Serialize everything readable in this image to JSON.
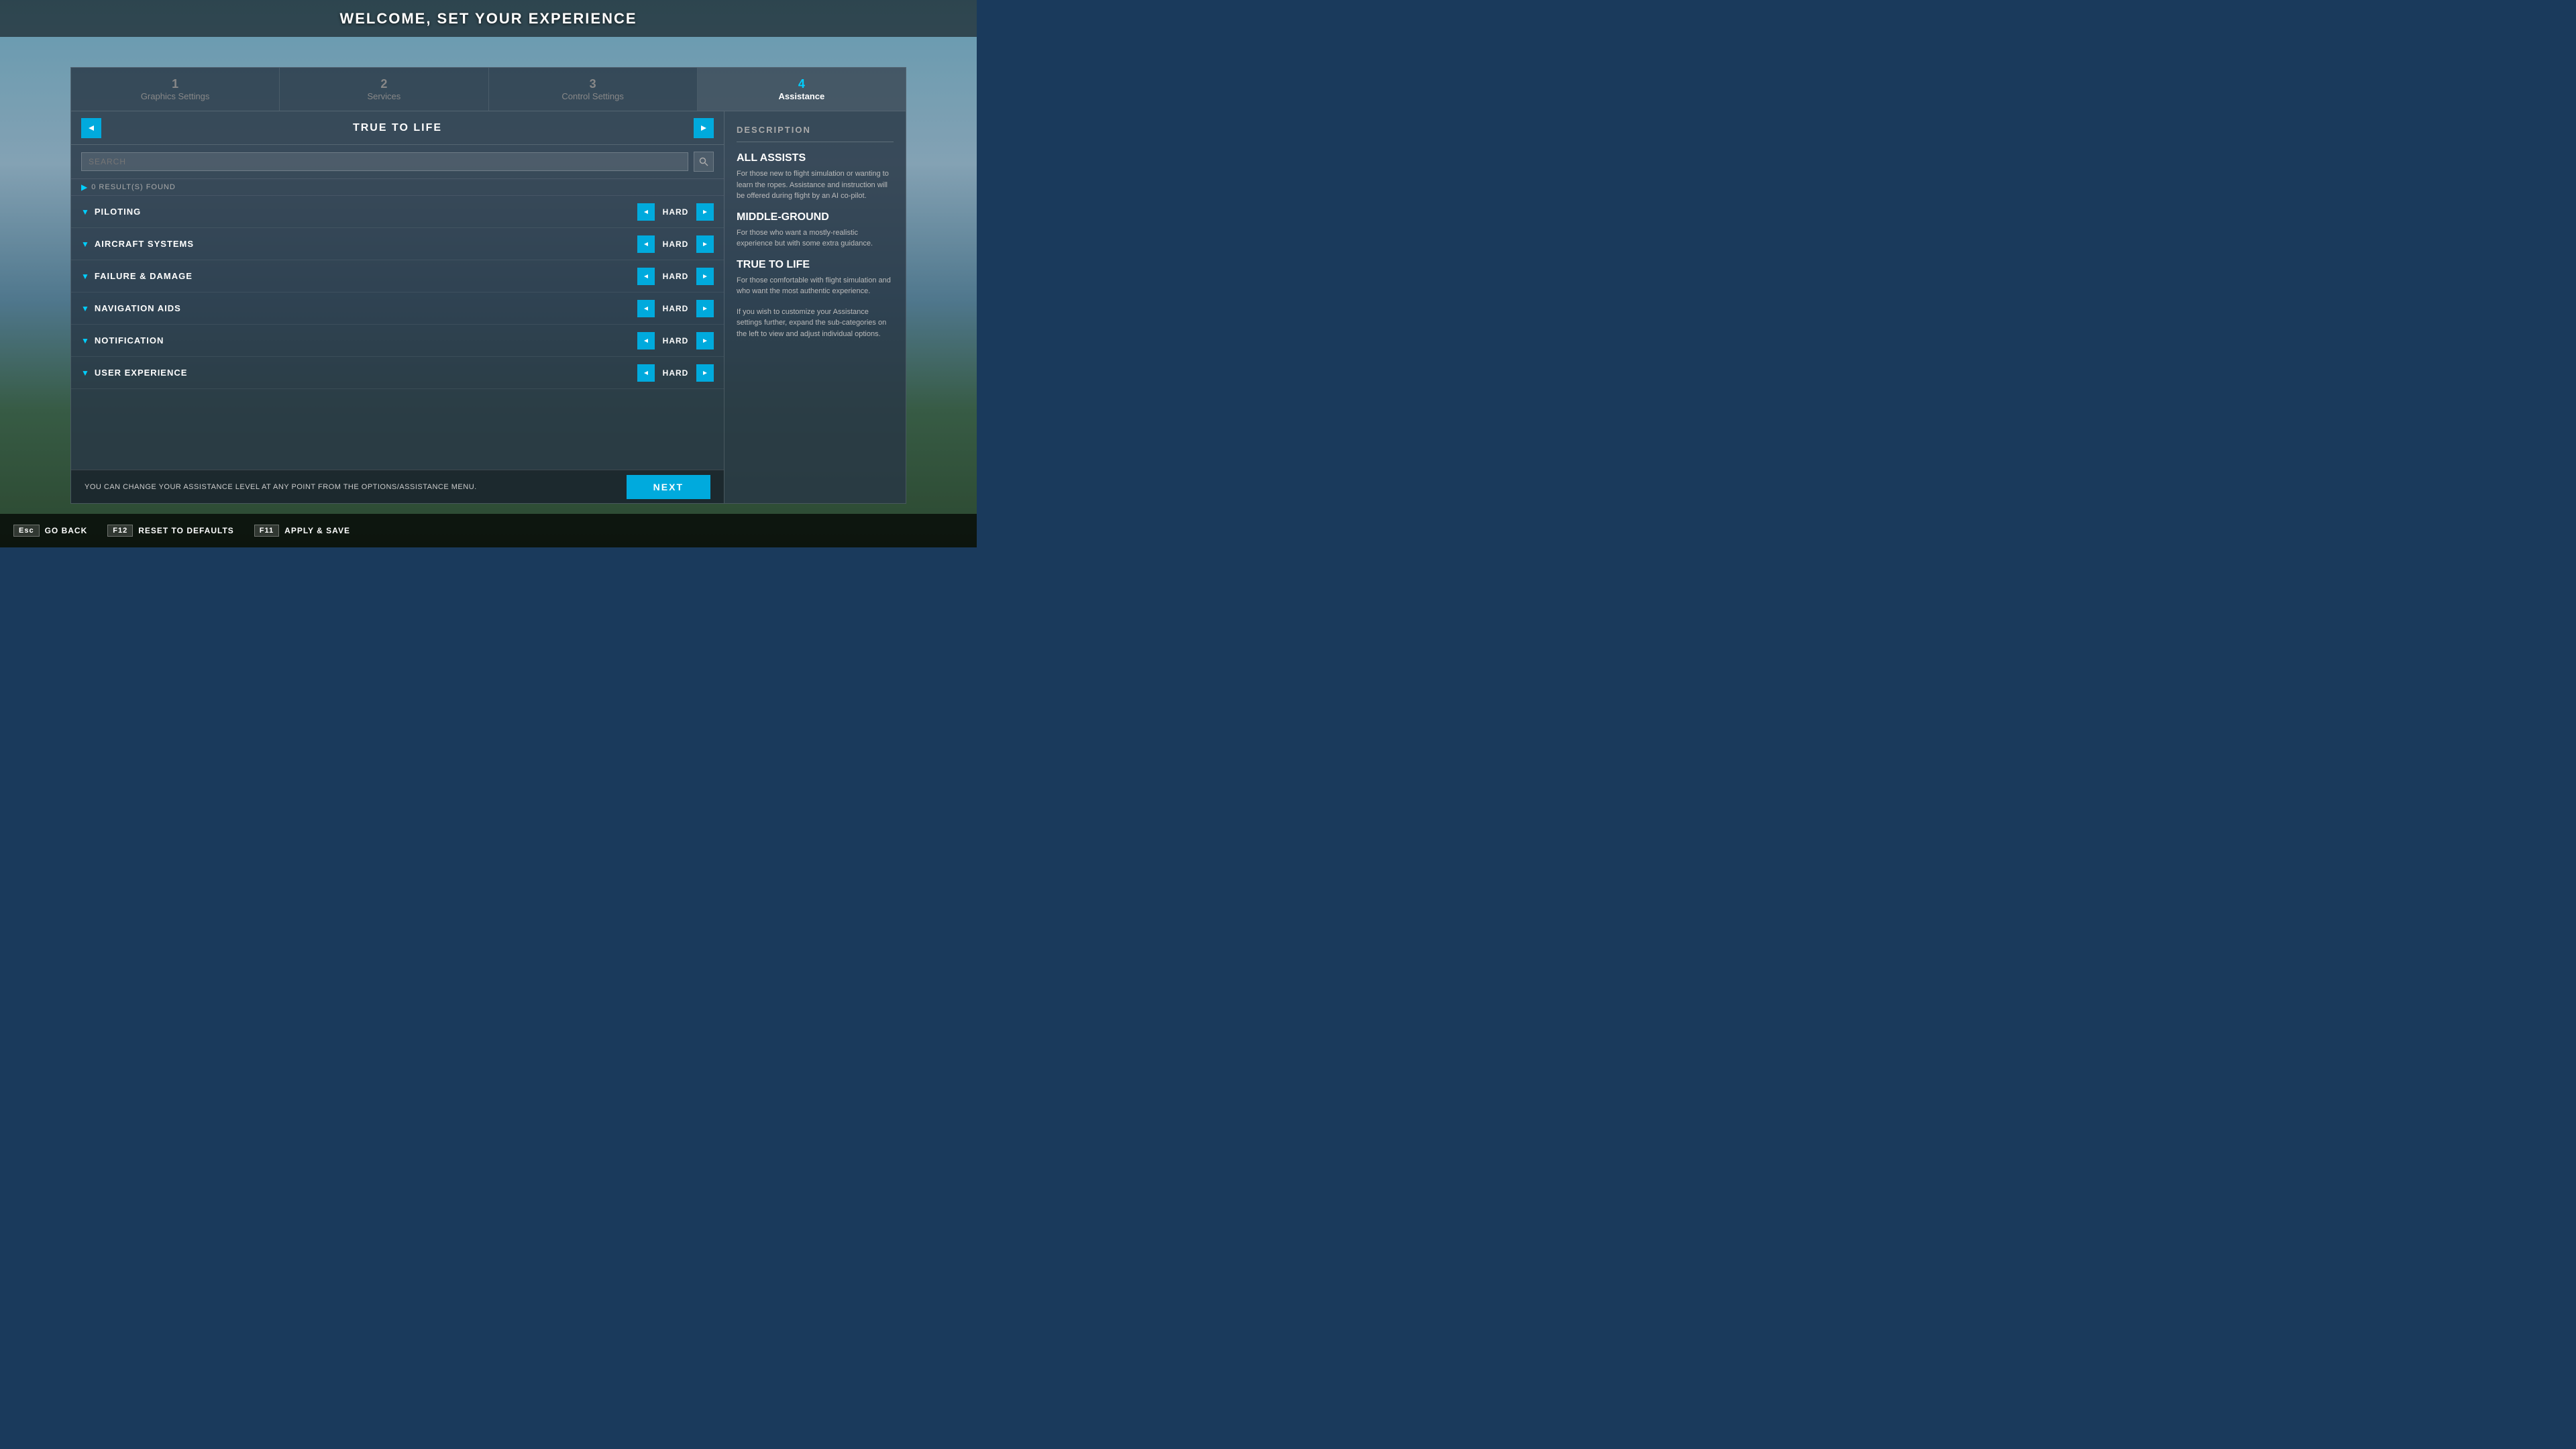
{
  "page": {
    "title": "WELCOME, SET YOUR EXPERIENCE"
  },
  "steps": [
    {
      "num": "1",
      "label": "Graphics Settings",
      "active": false
    },
    {
      "num": "2",
      "label": "Services",
      "active": false
    },
    {
      "num": "3",
      "label": "Control Settings",
      "active": false
    },
    {
      "num": "4",
      "label": "Assistance",
      "active": true
    }
  ],
  "panel": {
    "prev_label": "◀",
    "next_label": "▶",
    "title": "TRUE TO LIFE",
    "search_placeholder": "SEARCH",
    "results_text": "0 RESULT(S) FOUND"
  },
  "categories": [
    {
      "name": "PILOTING",
      "value": "HARD"
    },
    {
      "name": "AIRCRAFT SYSTEMS",
      "value": "HARD"
    },
    {
      "name": "FAILURE & DAMAGE",
      "value": "HARD"
    },
    {
      "name": "NAVIGATION AIDS",
      "value": "HARD"
    },
    {
      "name": "NOTIFICATION",
      "value": "HARD"
    },
    {
      "name": "USER EXPERIENCE",
      "value": "HARD"
    }
  ],
  "description": {
    "heading": "DESCRIPTION",
    "sections": [
      {
        "title": "ALL ASSISTS",
        "text": "For those new to flight simulation or wanting to learn the ropes. Assistance and instruction will be offered during flight by an AI co-pilot."
      },
      {
        "title": "MIDDLE-GROUND",
        "text": "For those who want a mostly-realistic experience but with some extra guidance."
      },
      {
        "title": "TRUE TO LIFE",
        "text": "For those comfortable with flight simulation and who want the most authentic experience."
      }
    ],
    "extra_text": "If you wish to customize your Assistance settings further, expand the sub-categories on the left to view and adjust individual options."
  },
  "bottom": {
    "info_text": "YOU CAN CHANGE YOUR ASSISTANCE LEVEL AT ANY POINT FROM THE OPTIONS/ASSISTANCE MENU.",
    "next_label": "NEXT"
  },
  "footer": {
    "actions": [
      {
        "key": "Esc",
        "label": "GO BACK"
      },
      {
        "key": "F12",
        "label": "RESET TO DEFAULTS"
      },
      {
        "key": "F11",
        "label": "APPLY & SAVE"
      }
    ]
  }
}
